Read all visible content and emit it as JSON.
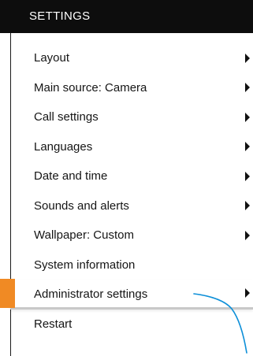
{
  "header": {
    "title": "SETTINGS"
  },
  "menu": {
    "items": [
      {
        "label": "Layout",
        "has_submenu": true
      },
      {
        "label": "Main source: Camera",
        "has_submenu": true
      },
      {
        "label": "Call settings",
        "has_submenu": true
      },
      {
        "label": "Languages",
        "has_submenu": true
      },
      {
        "label": "Date and time",
        "has_submenu": true
      },
      {
        "label": "Sounds and alerts",
        "has_submenu": true
      },
      {
        "label": "Wallpaper: Custom",
        "has_submenu": true
      },
      {
        "label": "System information",
        "has_submenu": false
      },
      {
        "label": "Administrator settings",
        "has_submenu": true,
        "selected": true
      },
      {
        "label": "Restart",
        "has_submenu": false
      }
    ]
  },
  "colors": {
    "header_background": "#0d0d0d",
    "header_text": "#ffffff",
    "selection_accent": "#f08a24",
    "pointer_line": "#0d8fd8"
  },
  "icons": {
    "submenu": "chevron-right-icon"
  }
}
